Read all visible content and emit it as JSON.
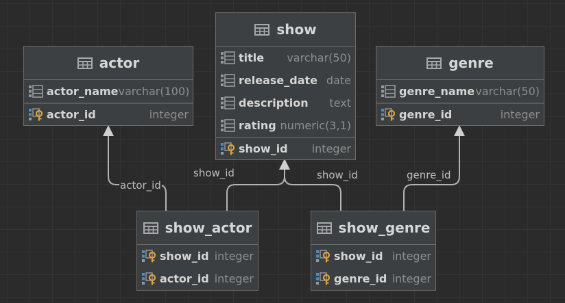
{
  "tables": {
    "show": {
      "name": "show",
      "columns": [
        {
          "name": "title",
          "type": "varchar(50)"
        },
        {
          "name": "release_date",
          "type": "date"
        },
        {
          "name": "description",
          "type": "text"
        },
        {
          "name": "rating",
          "type": "numeric(3,1)"
        }
      ],
      "keys": [
        {
          "name": "show_id",
          "type": "integer"
        }
      ]
    },
    "actor": {
      "name": "actor",
      "columns": [
        {
          "name": "actor_name",
          "type": "varchar(100)"
        }
      ],
      "keys": [
        {
          "name": "actor_id",
          "type": "integer"
        }
      ]
    },
    "genre": {
      "name": "genre",
      "columns": [
        {
          "name": "genre_name",
          "type": "varchar(50)"
        }
      ],
      "keys": [
        {
          "name": "genre_id",
          "type": "integer"
        }
      ]
    },
    "show_actor": {
      "name": "show_actor",
      "columns": [],
      "keys": [
        {
          "name": "show_id",
          "type": "integer"
        },
        {
          "name": "actor_id",
          "type": "integer"
        }
      ]
    },
    "show_genre": {
      "name": "show_genre",
      "columns": [],
      "keys": [
        {
          "name": "show_id",
          "type": "integer"
        },
        {
          "name": "genre_id",
          "type": "integer"
        }
      ]
    }
  },
  "relations": [
    {
      "from": "show_actor",
      "to": "actor",
      "label": "actor_id"
    },
    {
      "from": "show_actor",
      "to": "show",
      "label": "show_id"
    },
    {
      "from": "show_genre",
      "to": "show",
      "label": "show_id"
    },
    {
      "from": "show_genre",
      "to": "genre",
      "label": "genre_id"
    }
  ],
  "colors": {
    "background": "#2b2b2b",
    "grid": "#333333",
    "table_fill": "#3c3f41",
    "table_border": "#6b6b6b",
    "edge": "#b4b4b4",
    "key_icon": "#e0a23a",
    "column_icon": "#9a9a9a"
  }
}
